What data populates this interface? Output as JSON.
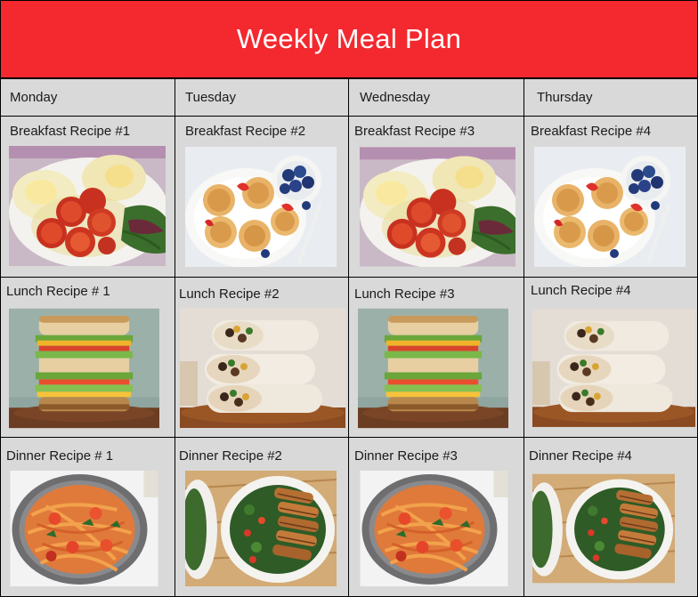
{
  "header": {
    "title": "Weekly Meal Plan"
  },
  "days": [
    {
      "name": "Monday",
      "breakfast": {
        "label": "Breakfast Recipe #1",
        "image": "eggs-tomatoes-greens-plate"
      },
      "lunch": {
        "label": "Lunch Recipe # 1",
        "image": "stacked-sandwich"
      },
      "dinner": {
        "label": "Dinner Recipe # 1",
        "image": "shrimp-spaghetti-bowl"
      }
    },
    {
      "name": "Tuesday",
      "breakfast": {
        "label": "Breakfast Recipe #2",
        "image": "pancakes-berries-plate"
      },
      "lunch": {
        "label": "Lunch Recipe #2",
        "image": "stacked-burritos"
      },
      "dinner": {
        "label": "Dinner Recipe #2",
        "image": "chicken-kale-salad"
      }
    },
    {
      "name": "Wednesday",
      "breakfast": {
        "label": "Breakfast Recipe #3",
        "image": "eggs-tomatoes-greens-plate"
      },
      "lunch": {
        "label": "Lunch Recipe #3",
        "image": "stacked-sandwich"
      },
      "dinner": {
        "label": "Dinner Recipe #3",
        "image": "shrimp-spaghetti-bowl"
      }
    },
    {
      "name": "Thursday",
      "breakfast": {
        "label": "Breakfast Recipe #4",
        "image": "pancakes-berries-plate"
      },
      "lunch": {
        "label": "Lunch Recipe #4",
        "image": "stacked-burritos"
      },
      "dinner": {
        "label": "Dinner Recipe #4",
        "image": "chicken-kale-salad"
      }
    }
  ],
  "colors": {
    "header_bg": "#f3292f",
    "header_text": "#ffffff",
    "cell_bg": "#d9d9d9",
    "border": "#000000"
  }
}
